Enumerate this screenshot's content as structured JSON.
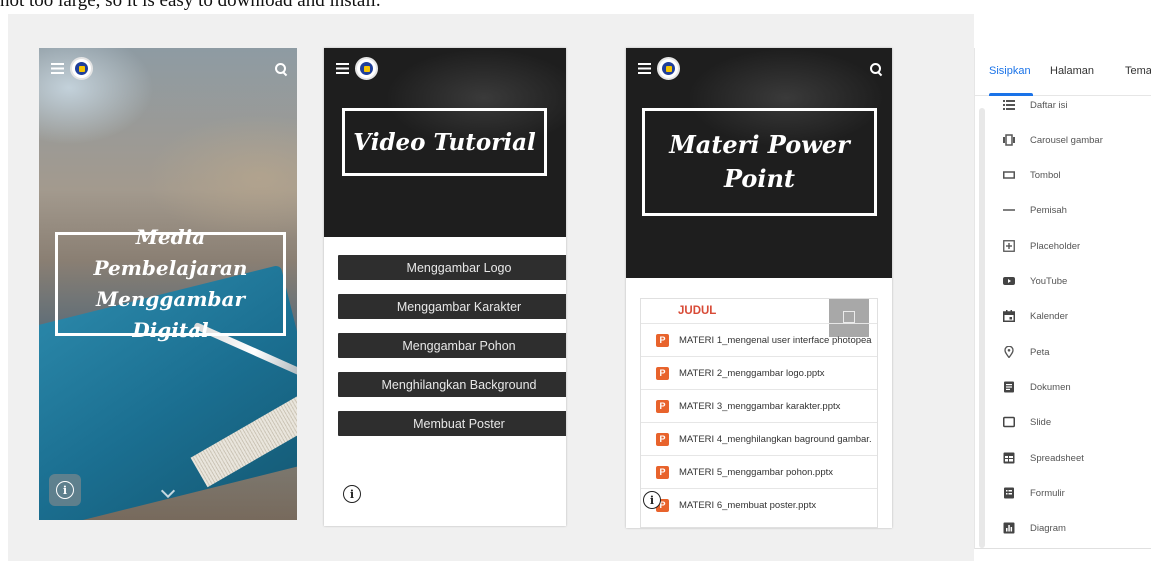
{
  "caption": "not too large, so it is easy to download and install.",
  "phone_home": {
    "title_line1": "Media Pembelajaran",
    "title_line2": "Menggambar Digital",
    "info_icon": "i"
  },
  "phone_video": {
    "title": "Video Tutorial",
    "buttons": [
      "Menggambar Logo",
      "Menggambar Karakter",
      "Menggambar Pohon",
      "Menghilangkan Background",
      "Membuat Poster"
    ],
    "info_icon": "i"
  },
  "phone_materi": {
    "title_line1": "Materi Power",
    "title_line2": "Point",
    "table_header": "JUDUL",
    "ppt_icon": "P",
    "files": [
      "MATERI 1_mengenal user interface photopea",
      "MATERI 2_menggambar logo.pptx",
      "MATERI 3_menggambar karakter.pptx",
      "MATERI 4_menghilangkan baground gambar.",
      "MATERI 5_menggambar pohon.pptx",
      "MATERI 6_membuat poster.pptx"
    ],
    "info_icon": "i"
  },
  "panel": {
    "tabs": [
      "Sisipkan",
      "Halaman",
      "Tema"
    ],
    "active_tab": "Sisipkan",
    "items": [
      {
        "label": "Daftar isi",
        "icon": "list-icon"
      },
      {
        "label": "Carousel gambar",
        "icon": "carousel-icon"
      },
      {
        "label": "Tombol",
        "icon": "button-icon"
      },
      {
        "label": "Pemisah",
        "icon": "divider-icon"
      },
      {
        "label": "Placeholder",
        "icon": "placeholder-icon"
      },
      {
        "label": "YouTube",
        "icon": "youtube-icon"
      },
      {
        "label": "Kalender",
        "icon": "calendar-icon"
      },
      {
        "label": "Peta",
        "icon": "map-pin-icon"
      },
      {
        "label": "Dokumen",
        "icon": "document-icon"
      },
      {
        "label": "Slide",
        "icon": "slide-icon"
      },
      {
        "label": "Spreadsheet",
        "icon": "spreadsheet-icon"
      },
      {
        "label": "Formulir",
        "icon": "form-icon"
      },
      {
        "label": "Diagram",
        "icon": "chart-icon"
      }
    ]
  },
  "colors": {
    "accent": "#1a73e8",
    "button_bg": "#2e2e2e",
    "table_header": "#d84a36",
    "ppt_icon": "#e8632c"
  }
}
